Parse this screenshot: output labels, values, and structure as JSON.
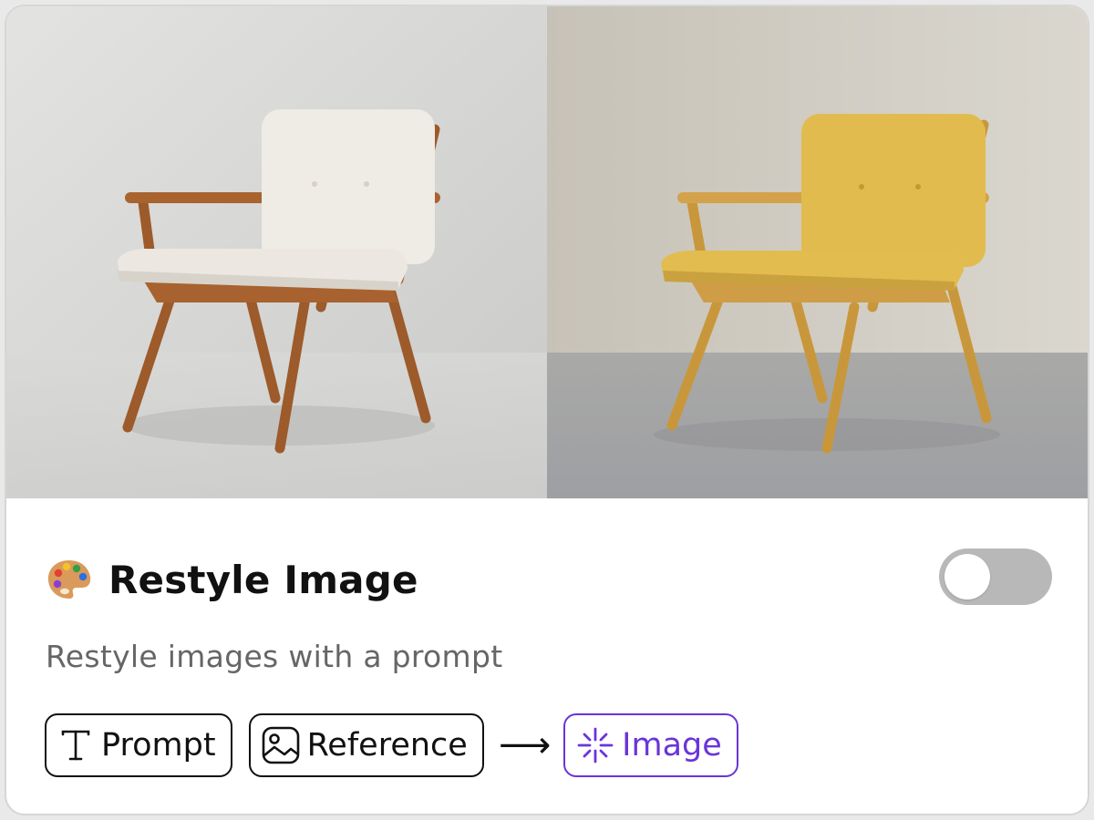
{
  "card": {
    "title": "Restyle Image",
    "subtitle": "Restyle images with a prompt",
    "toggle_on": false
  },
  "icons": {
    "title_icon": "artist-palette-icon",
    "prompt_icon": "text-cursor-icon",
    "reference_icon": "image-icon",
    "output_icon": "sparkle-icon",
    "arrow_icon": "right-arrow-icon"
  },
  "flow": {
    "inputs": [
      {
        "label": "Prompt"
      },
      {
        "label": "Reference"
      }
    ],
    "arrow": "⟶",
    "output": {
      "label": "Image"
    }
  },
  "colors": {
    "accent": "#6a35d9",
    "toggle_off": "#b8b8b8",
    "subtitle": "#666666"
  }
}
